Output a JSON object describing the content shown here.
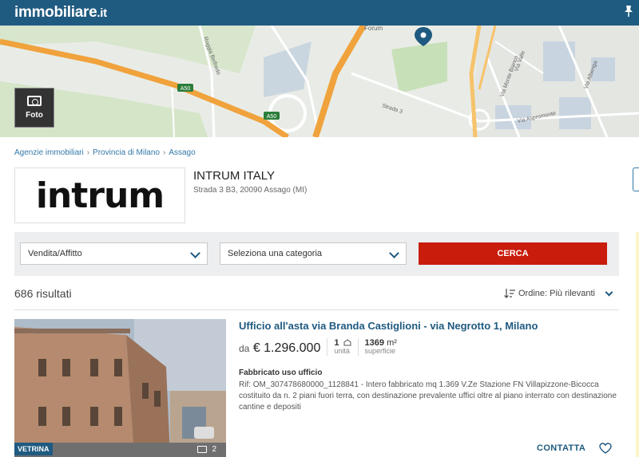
{
  "header": {
    "logo_text": "immobiliare",
    "logo_ext": ".it",
    "colors": {
      "bar": "#1f5a80"
    }
  },
  "map": {
    "foto_label": "Foto",
    "road_labels": [
      "Forum",
      "A50",
      "A50",
      "Strada 3",
      "Via Monte Bianco",
      "Via Valle",
      "Via Aspromonte",
      "Via Albenga",
      "Roggia Belfredo"
    ]
  },
  "breadcrumb": {
    "items": [
      "Agenzie immobiliari",
      "Provincia di Milano",
      "Assago"
    ]
  },
  "agency": {
    "logo_word": "intrum",
    "name": "INTRUM ITALY",
    "address": "Strada 3 B3, 20090 Assago (MI)"
  },
  "search": {
    "contract_select": "Vendita/Affitto",
    "category_select": "Seleziona una categoria",
    "button_label": "CERCA",
    "colors": {
      "button": "#c91c0d"
    }
  },
  "results": {
    "count_text": "686 risultati",
    "sort_label": "Ordine: Più rilevanti"
  },
  "listing": {
    "title": "Ufficio all'asta via Branda Castiglioni - via Negrotto 1, Milano",
    "price_prefix": "da",
    "price": "€ 1.296.000",
    "units_value": "1",
    "units_label": "unità",
    "surface_value": "1369",
    "surface_unit": "m²",
    "surface_label": "superficie",
    "badge": "VETRINA",
    "photo_count": "2",
    "desc_title": "Fabbricato uso ufficio",
    "desc": "Rif: OM_307478680000_1128841 - Intero fabbricato mq 1.369 V.Ze Stazione FN Villapizzone-Bicocca costituito da n. 2 piani fuori terra, con destinazione prevalente uffici oltre al piano interrato con destinazione cantine e depositi",
    "contact_label": "CONTATTA"
  }
}
